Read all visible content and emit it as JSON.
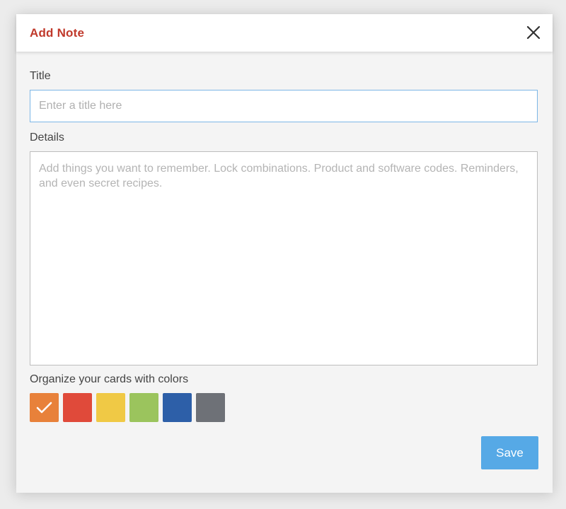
{
  "modal": {
    "title": "Add Note",
    "close_icon": "close-icon"
  },
  "form": {
    "title_label": "Title",
    "title_value": "",
    "title_placeholder": "Enter a title here",
    "details_label": "Details",
    "details_value": "",
    "details_placeholder": "Add things you want to remember. Lock combinations. Product and software codes. Reminders, and even secret recipes.",
    "colors_label": "Organize your cards with colors",
    "colors": [
      {
        "name": "orange",
        "hex": "#e8813a",
        "selected": true
      },
      {
        "name": "red",
        "hex": "#e04a3a",
        "selected": false
      },
      {
        "name": "yellow",
        "hex": "#f0c945",
        "selected": false
      },
      {
        "name": "green",
        "hex": "#9bc45d",
        "selected": false
      },
      {
        "name": "blue",
        "hex": "#2d5fa8",
        "selected": false
      },
      {
        "name": "gray",
        "hex": "#6e7177",
        "selected": false
      }
    ],
    "save_label": "Save"
  },
  "theme": {
    "title_color": "#c0392b",
    "accent": "#56a9e6"
  }
}
